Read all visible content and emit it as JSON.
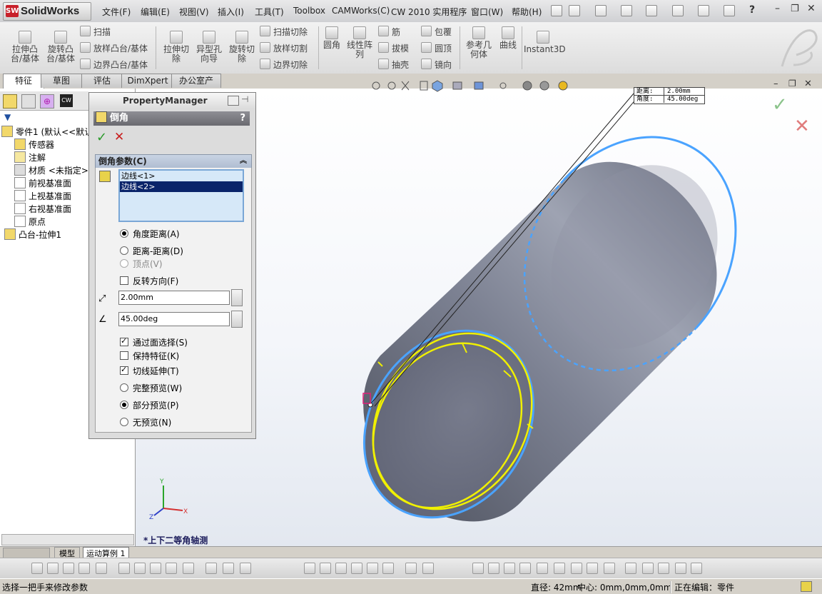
{
  "app": {
    "logo_text": "SolidWorks",
    "logo_badge": "SW"
  },
  "menu": [
    "文件(F)",
    "编辑(E)",
    "视图(V)",
    "插入(I)",
    "工具(T)",
    "Toolbox",
    "CAMWorks(C)",
    "CW 2010 实用程序",
    "窗口(W)",
    "帮助(H)"
  ],
  "ribbon": {
    "extrude_boss": "拉伸凸\n台/基体",
    "revolve_boss": "旋转凸\n台/基体",
    "sweep": "扫描",
    "loft_boss": "放样凸台/基体",
    "boundary_boss": "边界凸台/基体",
    "extrude_cut": "拉伸切\n除",
    "hole_wizard": "异型孔\n向导",
    "revolve_cut": "旋转切\n除",
    "sweep_cut": "扫描切除",
    "loft_cut": "放样切割",
    "boundary_cut": "边界切除",
    "fillet": "圆角",
    "linear_pattern": "线性阵\n列",
    "rib": "筋",
    "draft": "拔模",
    "shell": "抽壳",
    "wrap": "包覆",
    "dome": "圆顶",
    "mirror": "镜向",
    "ref_geometry": "参考几\n何体",
    "curves": "曲线",
    "instant3d": "Instant3D"
  },
  "tabs": [
    "特征",
    "草图",
    "评估",
    "DimXpert",
    "办公室产品"
  ],
  "tree": {
    "part": "零件1 (默认<<默认",
    "items": [
      "传感器",
      "注解",
      "材质 <未指定>",
      "前视基准面",
      "上视基准面",
      "右视基准面",
      "原点",
      "凸台-拉伸1"
    ]
  },
  "property_manager": {
    "header": "PropertyManager",
    "feature_title": "倒角",
    "help": "?",
    "section_title": "倒角参数(C)",
    "edges": [
      "边线<1>",
      "边线<2>"
    ],
    "options": {
      "angle_distance": "角度距离(A)",
      "distance_distance": "距离-距离(D)",
      "vertex": "顶点(V)",
      "flip_direction": "反转方向(F)",
      "distance_value": "2.00mm",
      "angle_value": "45.00deg",
      "select_through_faces": "通过面选择(S)",
      "keep_features": "保持特征(K)",
      "tangent_propagation": "切线延伸(T)",
      "full_preview": "完整预览(W)",
      "partial_preview": "部分预览(P)",
      "no_preview": "无预览(N)"
    }
  },
  "callout": {
    "distance_label": "距离:",
    "distance_value": "2.00mm",
    "angle_label": "角度:",
    "angle_value": "45.00deg"
  },
  "view_label": "*上下二等角轴测",
  "bottom_tabs": [
    "模型",
    "运动算例 1"
  ],
  "status": {
    "left": "选择一把手来修改参数",
    "diameter": "直径: 42mm",
    "center": "中心: 0mm,0mm,0mm",
    "editing": "正在编辑：零件"
  },
  "colors": {
    "accent_selection": "#0a246a",
    "edge_highlight": "#4aa3ff",
    "preview_yellow": "#f0f000",
    "body_gray": "#6e7283"
  }
}
